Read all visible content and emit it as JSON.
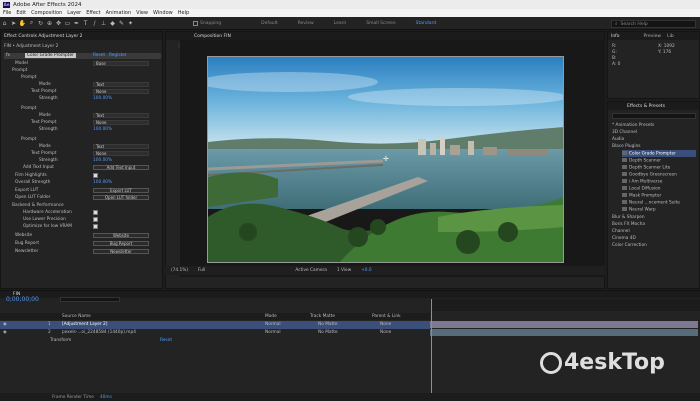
{
  "app": {
    "title": "Adobe After Effects 2024",
    "logo": "Ae"
  },
  "menu": [
    "File",
    "Edit",
    "Composition",
    "Layer",
    "Effect",
    "Animation",
    "View",
    "Window",
    "Help"
  ],
  "toolbar": {
    "snapping": "Snapping",
    "workspaces": [
      "Default",
      "Review",
      "Learn",
      "Small Screen",
      "Standard"
    ],
    "active_workspace": "Standard",
    "search_placeholder": "Search Help"
  },
  "effect_panel": {
    "tab": "Effect Controls Adjustment Layer 2",
    "breadcrumb": "FIN • Adjustment Layer 2",
    "effect_name": "Color Grade Prompter",
    "reset": "Reset",
    "register": "Register",
    "model_label": "Model",
    "model_value": "Base",
    "prompt_group": "Prompt",
    "prompts": [
      {
        "label": "Prompt",
        "mode_label": "Mode",
        "mode": "Text",
        "tp_label": "Text Prompt",
        "tp": "None",
        "st_label": "Strength",
        "strength": "100.00%"
      },
      {
        "label": "Prompt",
        "mode_label": "Mode",
        "mode": "Text",
        "tp_label": "Text Prompt",
        "tp": "None",
        "st_label": "Strength",
        "strength": "100.00%"
      },
      {
        "label": "Prompt",
        "mode_label": "Mode",
        "mode": "Text",
        "tp_label": "Text Prompt",
        "tp": "None",
        "st_label": "Strength",
        "strength": "100.00%"
      }
    ],
    "add_text_input": "Add Text Input",
    "add_text_input_btn": "Add Text Input",
    "film_highlights": "Film Highlights",
    "overall_strength": "Overall Strength",
    "overall_strength_val": "100.00%",
    "export_lut": "Export LUT",
    "export_lut_btn": "Export LUT",
    "open_lut": "Open LUT Folder",
    "open_lut_btn": "Open LUT folder",
    "backend": "Backend & Performance",
    "hw_accel": "Hardware Acceleration",
    "lower_precision": "Use Lower Precision",
    "low_vram": "Optimize for low VRAM",
    "website": "Website",
    "website_btn": "Website",
    "bug_report": "Bug Report",
    "bug_report_btn": "Bug Report",
    "newsletter": "Newsletter",
    "newsletter_btn": "Newsletter"
  },
  "composition": {
    "tab": "Composition FIN",
    "sub_tab": "FIN",
    "zoom": "(74.1%)",
    "quality": "Full",
    "camera": "Active Camera",
    "views": "1 View",
    "extra": "+0.0"
  },
  "info_panel": {
    "tabs": [
      "Info",
      "Preview",
      "Lib"
    ],
    "r": "R:",
    "g": "G:",
    "b": "B:",
    "a": "A:  0",
    "x": "X: 1092",
    "y": "Y: 176"
  },
  "effects_presets": {
    "tab": "Effects & Presets",
    "search_placeholder": "",
    "items": [
      "* Animation Presets",
      "3D Channel",
      "Audio",
      "Blace Plugins",
      "Color Grade Prompter",
      "Depth Scanner",
      "Depth Scanner Lite",
      "Goodbye Greenscreen",
      "i Am Multiverse",
      "Local Diffusion",
      "Mask Prompter",
      "Neural ...ncement Suite",
      "Neural Warp",
      "Blur & Sharpen",
      "Boris FX Mocha",
      "Channel",
      "Cinema 4D",
      "Color Correction"
    ],
    "highlighted": "Color Grade Prompter"
  },
  "timeline": {
    "tab": "FIN",
    "timecode": "0;00;00;00",
    "columns": {
      "source": "Source Name",
      "mode": "Mode",
      "trkmat": "Track Matte",
      "parent": "Parent & Link"
    },
    "layers": [
      {
        "num": "1",
        "name": "[Adjustment Layer 2]",
        "mode": "Normal",
        "matte": "No Matte",
        "parent": "None"
      },
      {
        "num": "2",
        "name": "pexels-...oi_2248584 (1440p).mp4",
        "mode": "Normal",
        "matte": "No Matte",
        "parent": "None"
      }
    ],
    "transform": "Transform",
    "reset": "Reset",
    "frame_render": "Frame Render Time",
    "frame_render_val": "40ms"
  },
  "watermark": {
    "text": "4eskTop"
  },
  "colors": {
    "accent": "#4e9bff",
    "highlight_row": "#3a4f7a",
    "track_clip": "#a49ec2"
  }
}
